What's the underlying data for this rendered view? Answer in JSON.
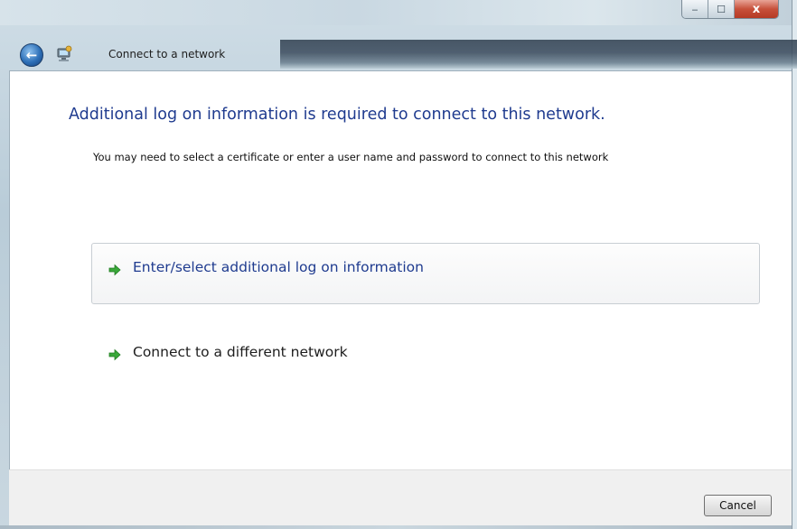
{
  "window": {
    "title": "Connect to a network",
    "caption_buttons": {
      "minimize": "‒",
      "maximize": "☐",
      "close": "x"
    }
  },
  "nav": {
    "back_icon": "back-arrow-icon",
    "network_icon": "network-wizard-icon"
  },
  "content": {
    "heading": "Additional log on information is required to connect to this network.",
    "description": "You may need to select a certificate or enter a user name and password to connect to this network",
    "options": [
      {
        "label": "Enter/select additional log on information",
        "icon": "green-arrow-icon",
        "highlighted": true
      },
      {
        "label": "Connect to a different network",
        "icon": "green-arrow-icon",
        "highlighted": false
      }
    ]
  },
  "footer": {
    "cancel_label": "Cancel"
  },
  "colors": {
    "heading": "#1f3b8f",
    "arrow": "#3aa83a",
    "close_button": "#c7503a"
  }
}
